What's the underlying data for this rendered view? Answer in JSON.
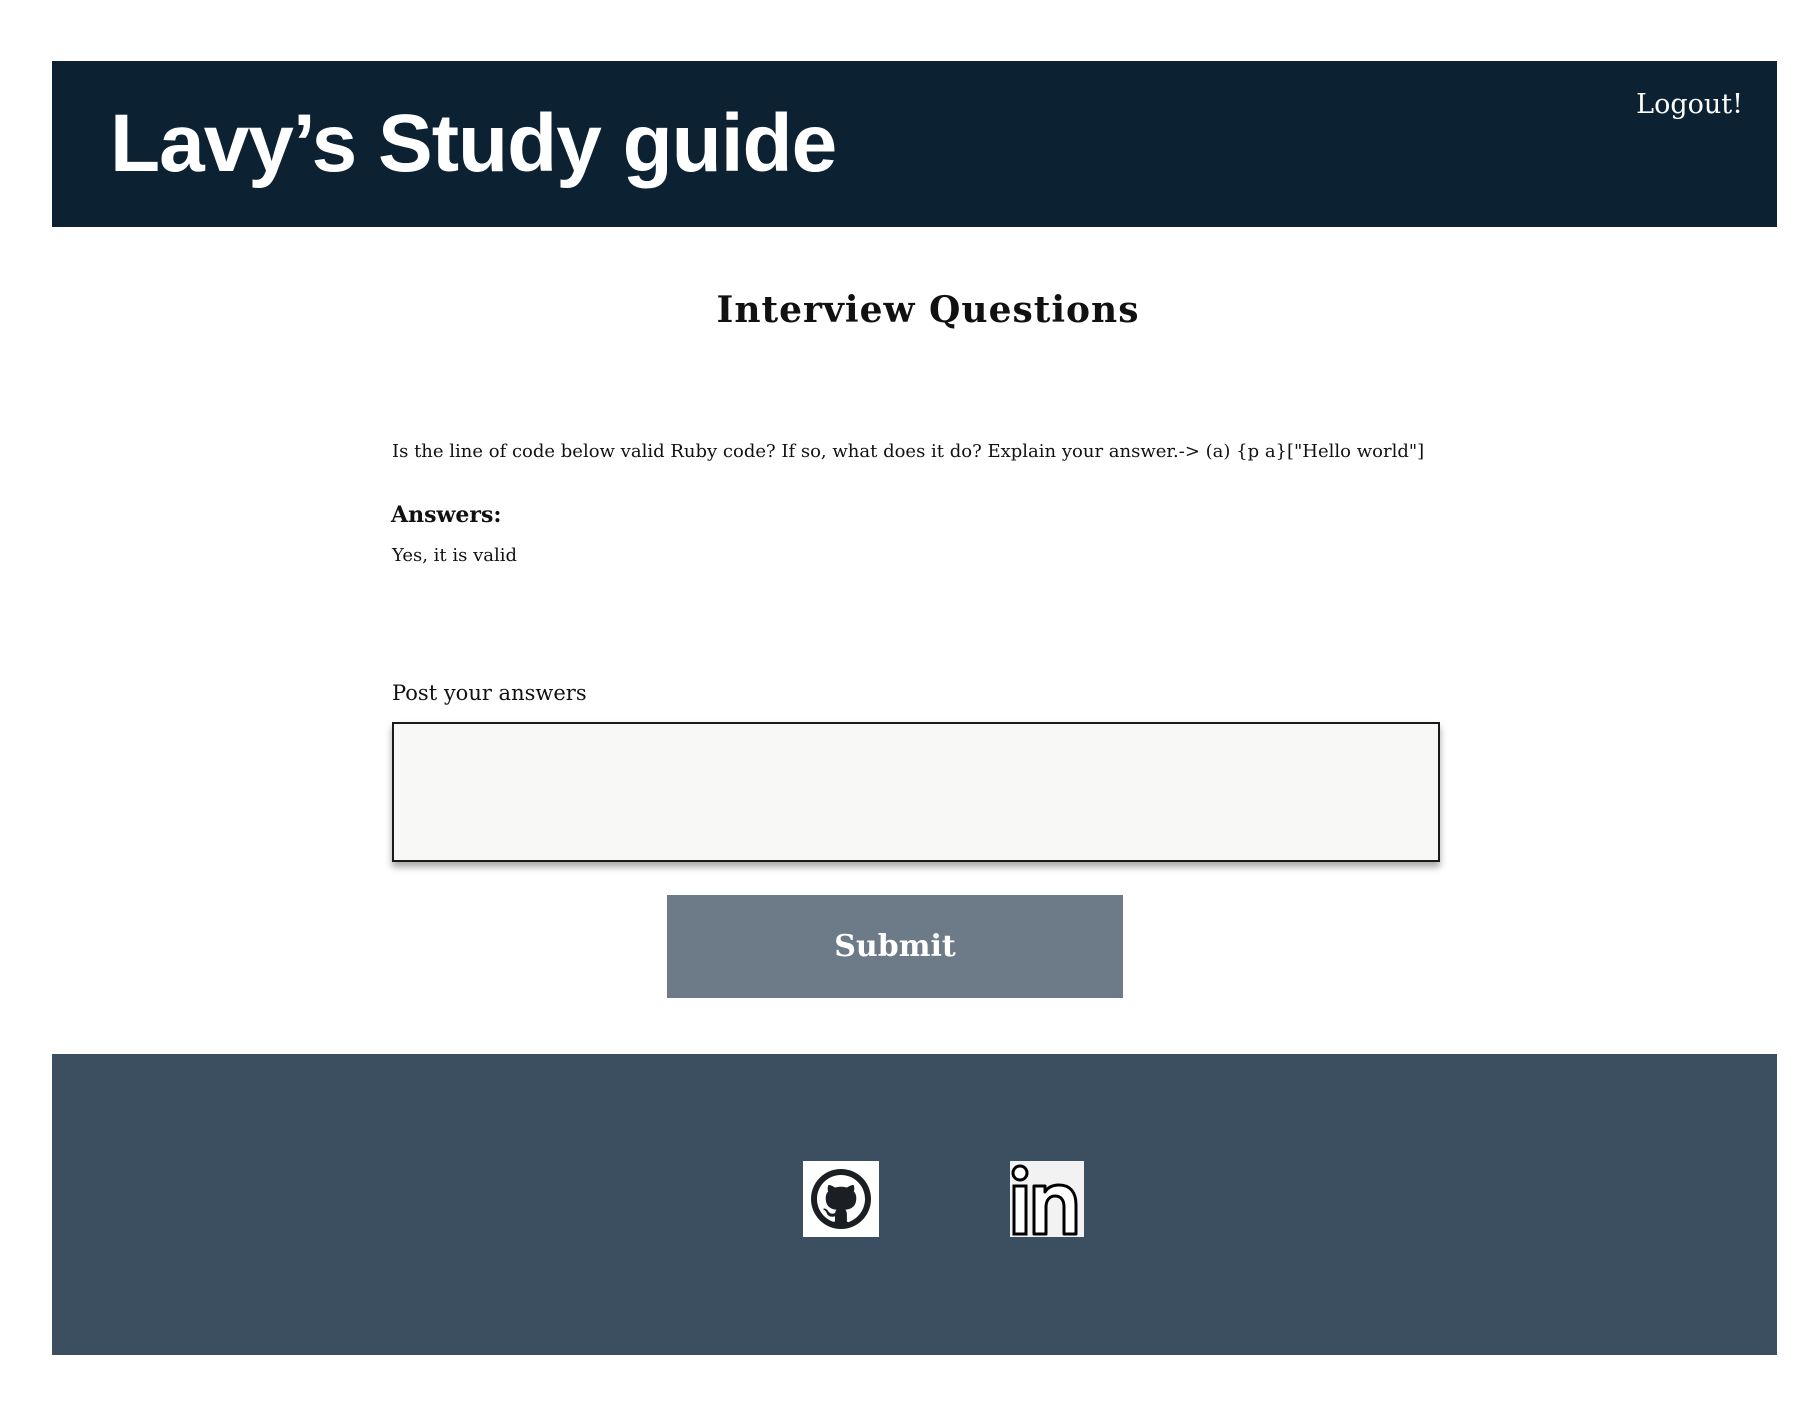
{
  "header": {
    "site_title": "Lavy’s Study guide",
    "logout_label": "Logout!"
  },
  "main": {
    "page_title": "Interview Questions",
    "question": "Is the line of code below valid Ruby code? If so, what does it do? Explain your answer.-> (a) {p a}[\"Hello world\"]",
    "answers_label": "Answers:",
    "answers": [
      "Yes, it is valid"
    ],
    "post_label": "Post your answers",
    "answer_input_value": "",
    "answer_input_placeholder": "",
    "submit_label": "Submit"
  },
  "footer": {
    "links": [
      {
        "icon": "github-icon"
      },
      {
        "icon": "linkedin-icon"
      }
    ]
  },
  "colors": {
    "header_bg": "#0c2233",
    "footer_bg": "#3b4f60",
    "submit_bg": "#6d7a87",
    "textarea_bg": "#f8f8f6"
  }
}
